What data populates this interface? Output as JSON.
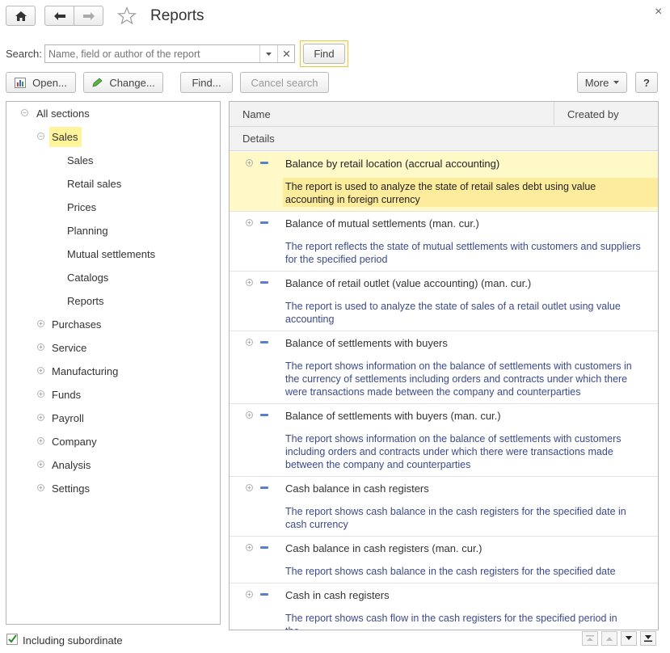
{
  "window": {
    "title": "Reports",
    "close_symbol": "×"
  },
  "search": {
    "label": "Search:",
    "placeholder": "Name, field or author of the report",
    "find_label": "Find"
  },
  "toolbar": {
    "open_label": "Open...",
    "change_label": "Change...",
    "find_label": "Find...",
    "cancel_search_label": "Cancel search",
    "more_label": "More",
    "help_label": "?"
  },
  "tree": {
    "root": "All sections",
    "selected": "Sales",
    "sales_children": [
      "Sales",
      "Retail sales",
      "Prices",
      "Planning",
      "Mutual settlements",
      "Catalogs",
      "Reports"
    ],
    "sections": [
      "Purchases",
      "Service",
      "Manufacturing",
      "Funds",
      "Payroll",
      "Company",
      "Analysis",
      "Settings"
    ]
  },
  "list": {
    "columns": {
      "name": "Name",
      "created_by": "Created by",
      "details": "Details"
    },
    "rows": [
      {
        "title": "Balance  by retail location (accrual accounting)",
        "desc": "The report is used to analyze the state of retail sales debt using value accounting in foreign currency"
      },
      {
        "title": "Balance of mutual settlements (man. cur.)",
        "desc": "The report reflects the state of mutual settlements with customers and suppliers for the specified period"
      },
      {
        "title": "Balance of retail outlet (value accounting) (man. cur.)",
        "desc": "The report is used to analyze the state of sales of a retail outlet using value accounting"
      },
      {
        "title": "Balance of settlements with buyers",
        "desc": "The report shows information on the balance of settlements with customers in the currency of settlements including orders and contracts under which there were transactions made between the company and counterparties"
      },
      {
        "title": "Balance of settlements with buyers (man. cur.)",
        "desc": "The report shows information on the balance of settlements with customers including orders and contracts under which there were transactions made between the company and counterparties"
      },
      {
        "title": "Cash balance in cash registers",
        "desc": "The report shows cash balance in the cash registers for the specified date in cash currency"
      },
      {
        "title": "Cash balance in cash registers (man. cur.)",
        "desc": "The report shows cash balance in the cash registers for the specified date"
      },
      {
        "title": "Cash in cash registers",
        "desc": "The report shows cash flow in the cash registers for the specified period in the..."
      }
    ]
  },
  "footer": {
    "including_subordinate": "Including subordinate",
    "checked": true
  },
  "colors": {
    "selection": "#fff9c8",
    "selection_desc": "#fcec9b",
    "link": "#3b4a8b",
    "accent_border": "#e6c84a"
  }
}
